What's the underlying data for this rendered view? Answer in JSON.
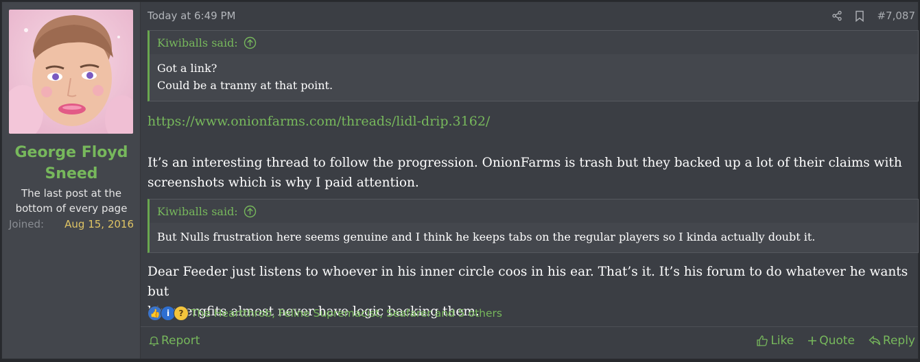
{
  "user": {
    "name_line1": "George Floyd",
    "name_line2": "Sneed",
    "title_line1": "The last post at the",
    "title_line2": "bottom of every page",
    "joined_label": "Joined:",
    "joined_value": "Aug 15, 2016"
  },
  "header": {
    "date": "Today at 6:49 PM",
    "post_number": "#7,087"
  },
  "quotes": [
    {
      "author": "Kiwiballs said:",
      "lines": [
        "Got a link?",
        "Could be a tranny at that point."
      ]
    },
    {
      "author": "Kiwiballs said:",
      "lines": [
        "But Nulls frustration here seems genuine and I think he keeps tabs on the regular players so I kinda actually doubt it."
      ]
    }
  ],
  "body": {
    "link": "https://www.onionfarms.com/threads/lidl-drip.3162/",
    "para1_line1": "It’s an interesting thread to follow the progression. OnionFarms is trash but they backed up a lot of their claims with",
    "para1_line2": "screenshots which is why I paid attention.",
    "para2_line1": "Dear Feeder just listens to whoever in his inner circle coos in his ear. That’s it. It’s his forum to do whatever he wants but",
    "para2_line2": "his spergfits almost never have logic backing them."
  },
  "reactions": {
    "icons": [
      "like-reaction-icon",
      "informative-reaction-icon",
      "thinking-reaction-icon"
    ],
    "text": "The Heartthrob, Feline Supremacist, Seafarer and 5 others"
  },
  "footer": {
    "report": "Report",
    "like": "Like",
    "quote": "Quote",
    "reply": "Reply"
  },
  "colors": {
    "accent": "#77b85c",
    "date_value": "#e0c565",
    "background": "#3b3e44"
  }
}
